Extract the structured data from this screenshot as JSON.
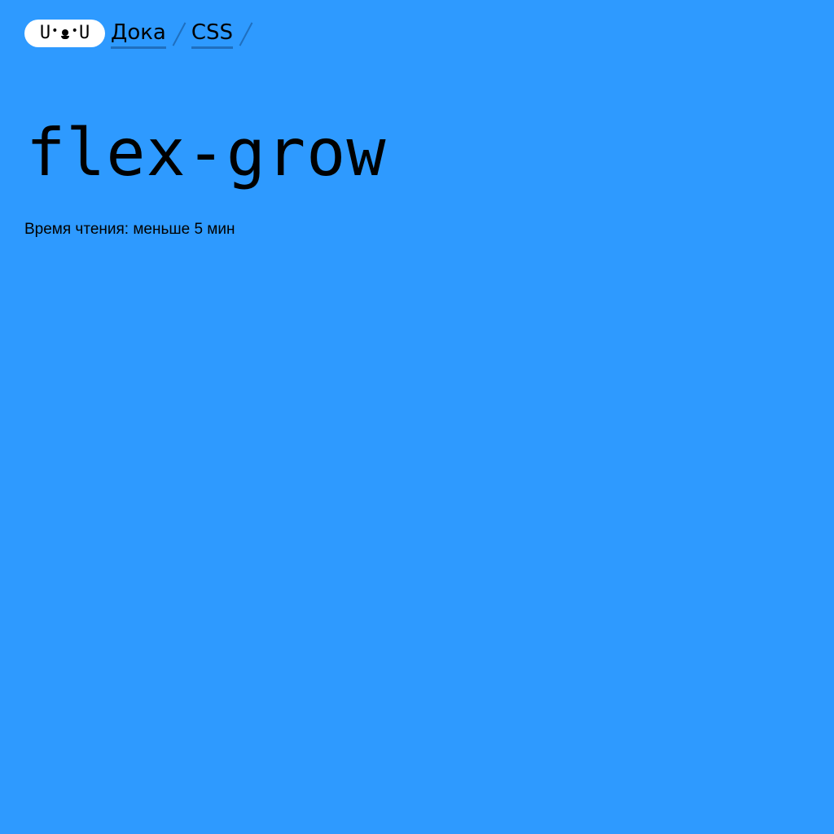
{
  "header": {
    "logo_text": "U•ᴥ•U",
    "breadcrumb": [
      {
        "label": "Дока"
      },
      {
        "label": "CSS"
      }
    ]
  },
  "main": {
    "title": "flex-grow",
    "reading_time": "Время чтения: меньше 5 мин"
  },
  "colors": {
    "background": "#2e9aff",
    "text": "#000000",
    "logo_bg": "#ffffff",
    "accent": "#1f6fbf"
  }
}
